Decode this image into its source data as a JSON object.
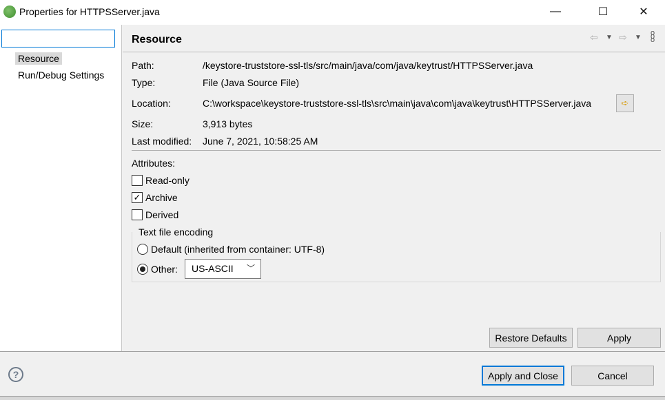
{
  "window": {
    "title": "Properties for HTTPSServer.java",
    "minimize": "—",
    "maximize": "☐",
    "close": "✕"
  },
  "filter": {
    "value": "",
    "placeholder": ""
  },
  "tree": [
    {
      "label": "Resource",
      "selected": true
    },
    {
      "label": "Run/Debug Settings"
    }
  ],
  "page": {
    "title": "Resource",
    "nav_icons": [
      "back-arrow-icon",
      "dropdown-icon",
      "forward-arrow-icon",
      "dropdown-icon",
      "menu-icon"
    ]
  },
  "info": {
    "path_label": "Path:",
    "path": "/keystore-truststore-ssl-tls/src/main/java/com/java/keytrust/HTTPSServer.java",
    "type_label": "Type:",
    "type": "File  (Java Source File)",
    "location_label": "Location:",
    "location": "C:\\workspace\\keystore-truststore-ssl-tls\\src\\main\\java\\com\\java\\keytrust\\HTTPSServer.java",
    "size_label": "Size:",
    "size": "3,913  bytes",
    "modified_label": "Last modified:",
    "modified": "June 7, 2021, 10:58:25 AM"
  },
  "attributes": {
    "label": "Attributes:",
    "items": [
      {
        "label": "Read-only",
        "checked": false
      },
      {
        "label": "Archive",
        "checked": true
      },
      {
        "label": "Derived",
        "checked": false
      }
    ]
  },
  "encoding": {
    "title": "Text file encoding",
    "default_label": "Default (inherited from container: UTF-8)",
    "other_label": "Other:",
    "selected": "other",
    "value": "US-ASCII"
  },
  "buttons": {
    "restore": "Restore Defaults",
    "apply": "Apply",
    "apply_close": "Apply and Close",
    "cancel": "Cancel",
    "help": "?"
  }
}
